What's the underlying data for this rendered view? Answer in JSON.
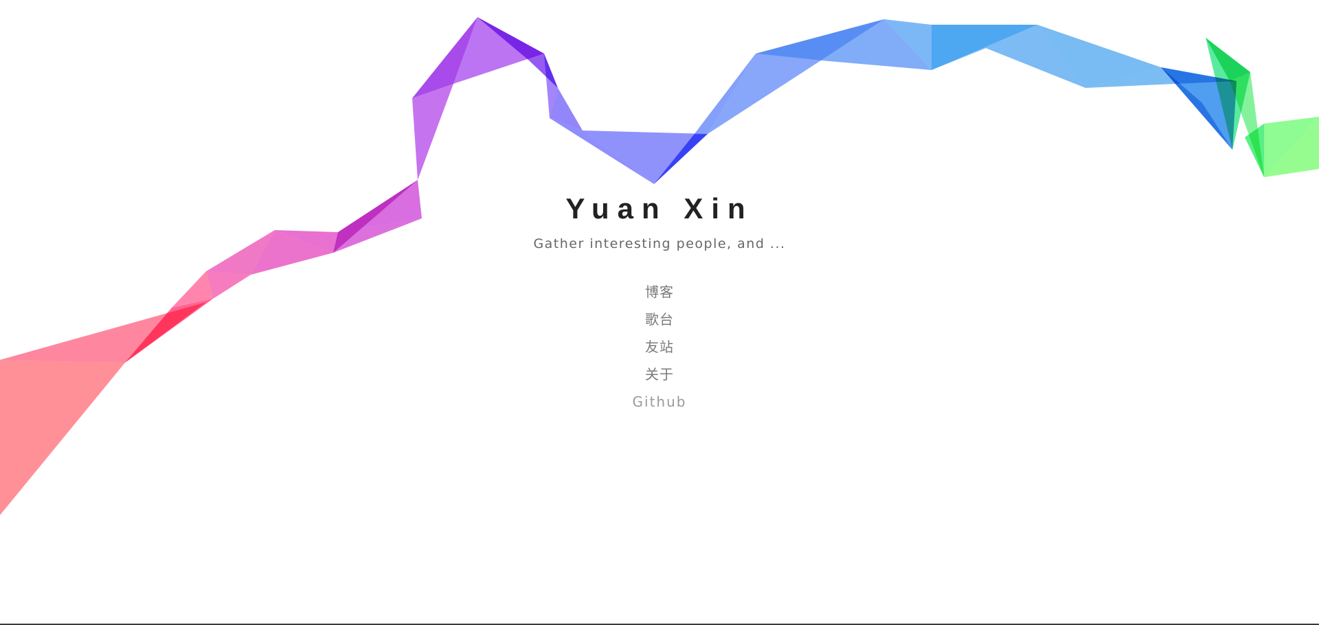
{
  "site": {
    "title": "Yuan Xin",
    "subtitle": "Gather interesting people, and ..."
  },
  "nav": {
    "items": [
      {
        "label": "博客"
      },
      {
        "label": "歌台"
      },
      {
        "label": "友站"
      },
      {
        "label": "关于"
      },
      {
        "label": "Github"
      }
    ]
  },
  "decoration": {
    "ribbon_colors": [
      "#ff8a92",
      "#ff6a9a",
      "#f06ac0",
      "#d050e0",
      "#a040f0",
      "#8a8cff",
      "#4a7ef5",
      "#3c9cf0",
      "#40e878",
      "#7cff80"
    ]
  }
}
